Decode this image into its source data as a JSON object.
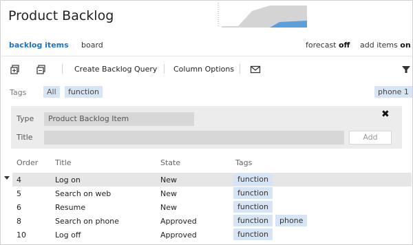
{
  "header": {
    "title": "Product Backlog"
  },
  "tabs": [
    {
      "label": "backlog items",
      "active": true
    },
    {
      "label": "board",
      "active": false
    }
  ],
  "forecast": {
    "label": "forecast",
    "value": "off"
  },
  "add_items": {
    "label": "add items",
    "value": "on"
  },
  "toolbar": {
    "expand_icon": "expand-all-icon",
    "collapse_icon": "collapse-all-icon",
    "create_query": "Create Backlog Query",
    "column_options": "Column Options",
    "mail_icon": "mail-icon",
    "filter_icon": "filter-icon"
  },
  "tag_filter": {
    "label": "Tags",
    "tags": [
      "All",
      "function"
    ],
    "right_tag": "phone 1"
  },
  "add_form": {
    "type_label": "Type",
    "type_value": "Product Backlog Item",
    "title_label": "Title",
    "title_value": "",
    "add_button": "Add"
  },
  "table": {
    "headers": [
      "Order",
      "Title",
      "State",
      "Tags"
    ],
    "rows": [
      {
        "order": "4",
        "title": "Log on",
        "state": "New",
        "tags": [
          "function"
        ],
        "selected": true
      },
      {
        "order": "5",
        "title": "Search on web",
        "state": "New",
        "tags": [
          "function"
        ]
      },
      {
        "order": "6",
        "title": "Resume",
        "state": "New",
        "tags": [
          "function"
        ]
      },
      {
        "order": "8",
        "title": "Search on phone",
        "state": "Approved",
        "tags": [
          "function",
          "phone"
        ]
      },
      {
        "order": "10",
        "title": "Log off",
        "state": "Approved",
        "tags": [
          "function"
        ]
      }
    ]
  },
  "colors": {
    "accent": "#1e73c9",
    "tag_bg": "#d6e5f5",
    "chart_grey": "#d4d4d4",
    "chart_blue": "#5aa0dc"
  }
}
